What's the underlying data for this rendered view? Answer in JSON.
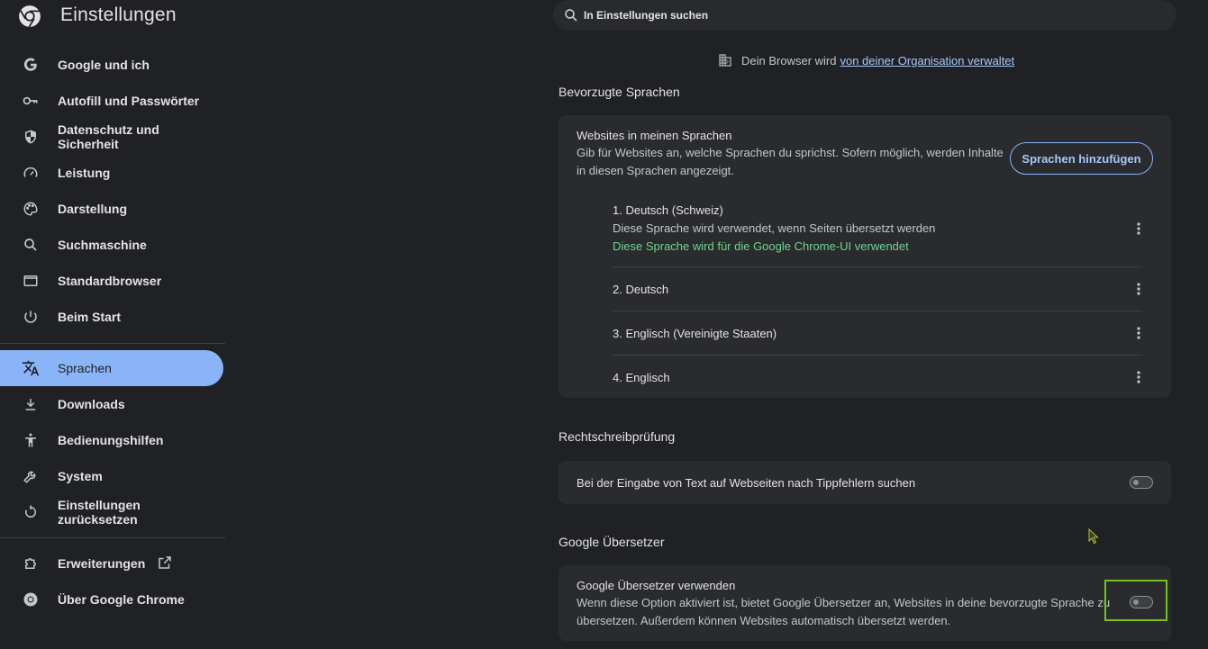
{
  "app": {
    "title": "Einstellungen",
    "logo_icon": "chrome-logo-icon"
  },
  "search": {
    "placeholder": "In Einstellungen suchen",
    "icon": "search-icon"
  },
  "managed": {
    "text": "Dein Browser wird",
    "link": "von deiner Organisation verwaltet",
    "icon": "building-icon"
  },
  "sidebar": {
    "items": [
      {
        "label": "Google und ich",
        "icon": "google-g-icon"
      },
      {
        "label": "Autofill und Passwörter",
        "icon": "key-icon"
      },
      {
        "label": "Datenschutz und Sicherheit",
        "icon": "shield-icon"
      },
      {
        "label": "Leistung",
        "icon": "speedometer-icon"
      },
      {
        "label": "Darstellung",
        "icon": "palette-icon"
      },
      {
        "label": "Suchmaschine",
        "icon": "search-icon"
      },
      {
        "label": "Standardbrowser",
        "icon": "browser-window-icon"
      },
      {
        "label": "Beim Start",
        "icon": "power-icon"
      },
      {
        "label": "Sprachen",
        "icon": "translate-icon",
        "active": true
      },
      {
        "label": "Downloads",
        "icon": "download-icon"
      },
      {
        "label": "Bedienungshilfen",
        "icon": "accessibility-icon"
      },
      {
        "label": "System",
        "icon": "wrench-icon"
      },
      {
        "label": "Einstellungen zurücksetzen",
        "icon": "reset-icon"
      },
      {
        "label": "Erweiterungen",
        "icon": "puzzle-icon",
        "external_icon": "external-link-icon"
      },
      {
        "label": "Über Google Chrome",
        "icon": "chrome-icon"
      }
    ]
  },
  "languages": {
    "section_title": "Bevorzugte Sprachen",
    "card_title": "Websites in meinen Sprachen",
    "card_desc_1": "Gib für Websites an, welche Sprachen du sprichst. Sofern möglich, werden Inhalte",
    "card_desc_2": "in diesen Sprachen angezeigt.",
    "add_button": "Sprachen hinzufügen",
    "list": [
      {
        "name": "1. Deutsch (Schweiz)",
        "sub": "Diese Sprache wird verwendet, wenn Seiten übersetzt werden",
        "ui": "Diese Sprache wird für die Google Chrome-UI verwendet"
      },
      {
        "name": "2. Deutsch"
      },
      {
        "name": "3. Englisch (Vereinigte Staaten)"
      },
      {
        "name": "4. Englisch"
      }
    ]
  },
  "spellcheck": {
    "section_title": "Rechtschreibprüfung",
    "row_label": "Bei der Eingabe von Text auf Webseiten nach Tippfehlern suchen",
    "enabled": false
  },
  "translate": {
    "section_title": "Google Übersetzer",
    "row_title": "Google Übersetzer verwenden",
    "row_desc_1": "Wenn diese Option aktiviert ist, bietet Google Übersetzer an, Websites in deine bevorzugte Sprache zu",
    "row_desc_2": "übersetzen. Außerdem können Websites automatisch übersetzt werden.",
    "enabled": false
  },
  "colors": {
    "accent": "#8ab4f8",
    "background": "#202124",
    "card": "#2a2b2e",
    "green_text": "#6dd58c",
    "highlight": "#73c31c"
  }
}
